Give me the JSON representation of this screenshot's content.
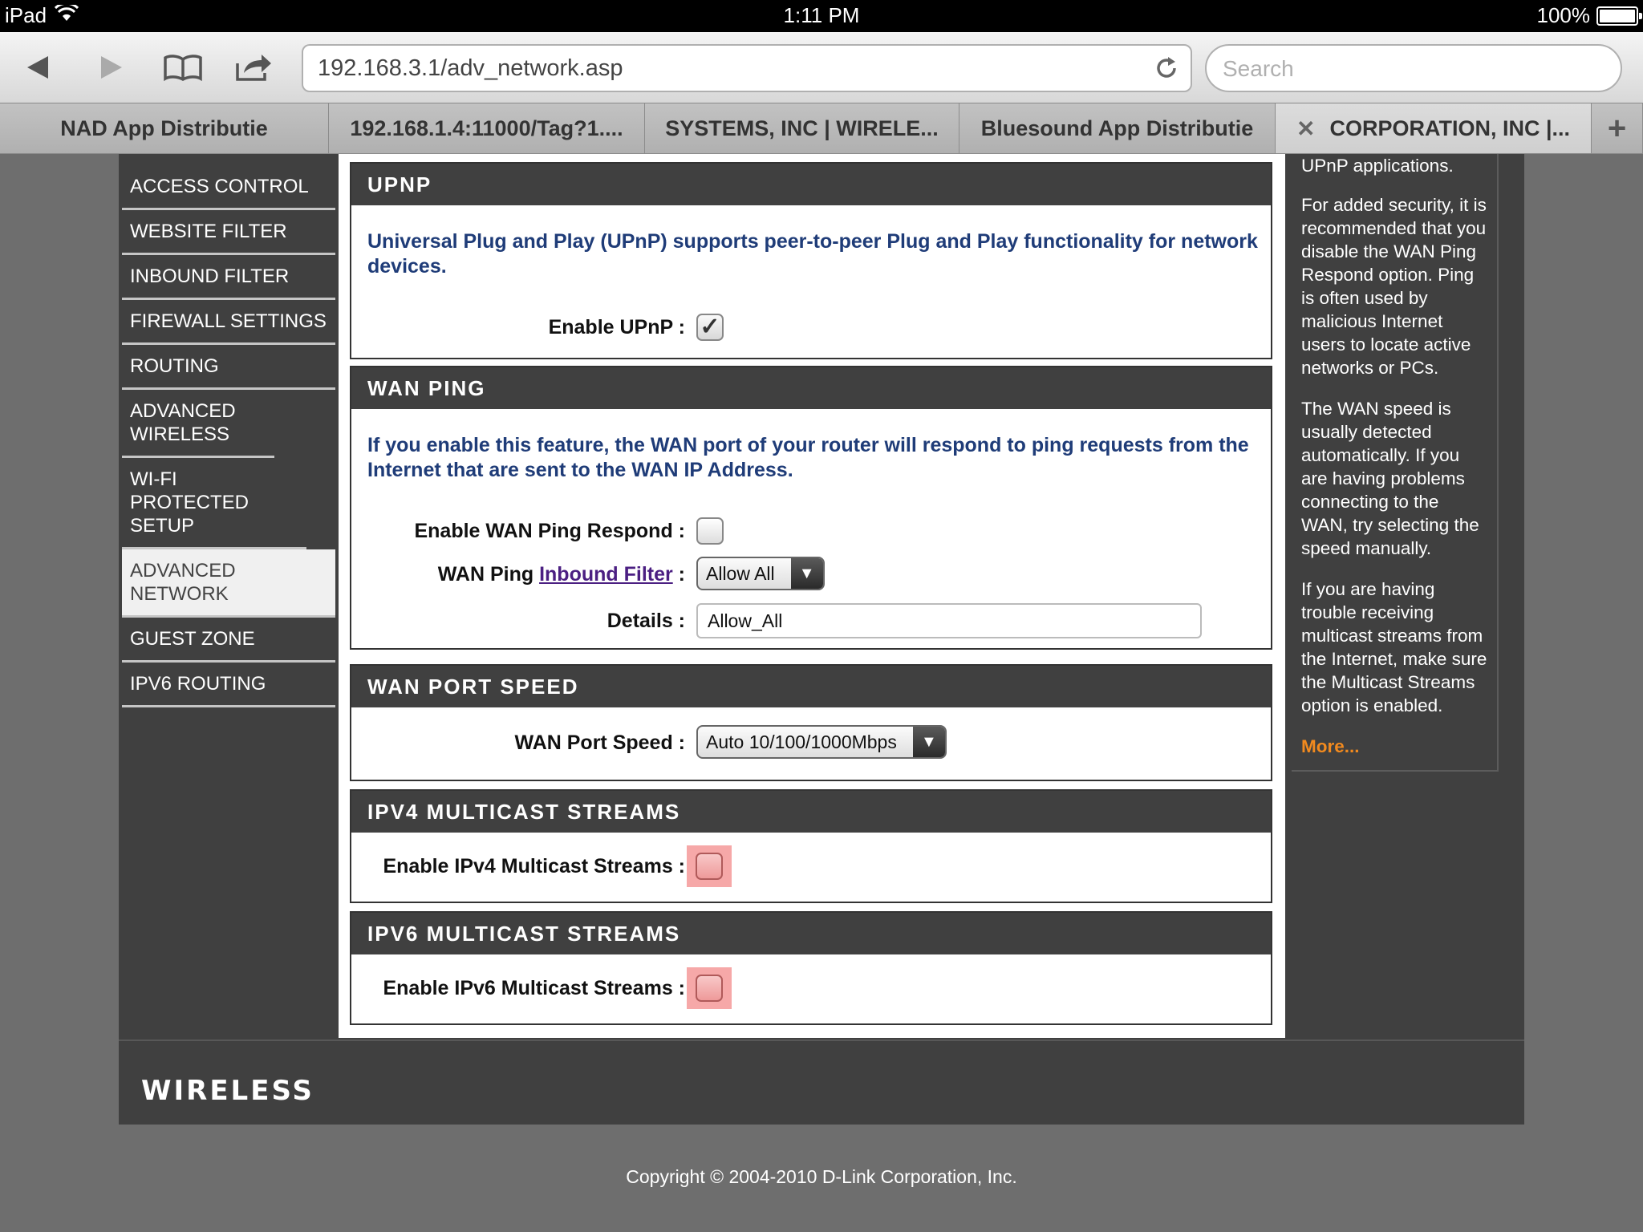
{
  "status_bar": {
    "device": "iPad",
    "time": "1:11 PM",
    "battery": "100%"
  },
  "browser": {
    "url": "192.168.3.1/adv_network.asp",
    "search_placeholder": "Search",
    "tabs": [
      {
        "label": "NAD App Distributie"
      },
      {
        "label": "192.168.1.4:11000/Tag?1...."
      },
      {
        "label": "SYSTEMS, INC | WIRELE..."
      },
      {
        "label": "Bluesound App Distributie"
      },
      {
        "label": "CORPORATION, INC |..."
      }
    ]
  },
  "sidebar": {
    "items": [
      {
        "label": "ACCESS CONTROL"
      },
      {
        "label": "WEBSITE FILTER"
      },
      {
        "label": "INBOUND FILTER"
      },
      {
        "label": "FIREWALL SETTINGS"
      },
      {
        "label": "ROUTING"
      },
      {
        "label": "ADVANCED WIRELESS"
      },
      {
        "label": "WI-FI PROTECTED SETUP"
      },
      {
        "label": "ADVANCED NETWORK"
      },
      {
        "label": "GUEST ZONE"
      },
      {
        "label": "IPV6 ROUTING"
      }
    ]
  },
  "upnp": {
    "title": "UPNP",
    "description": "Universal Plug and Play (UPnP) supports peer-to-peer Plug and Play functionality for network devices.",
    "enable_label": "Enable UPnP :",
    "enabled": true
  },
  "wan_ping": {
    "title": "WAN PING",
    "description": "If you enable this feature, the WAN port of your router will respond to ping requests from the Internet that are sent to the WAN IP Address.",
    "respond_label": "Enable WAN Ping Respond :",
    "respond_enabled": false,
    "filter_label_prefix": "WAN Ping",
    "filter_link": "Inbound Filter",
    "filter_label_suffix": ":",
    "filter_value": "Allow All",
    "details_label": "Details :",
    "details_value": "Allow_All"
  },
  "wan_port_speed": {
    "title": "WAN PORT SPEED",
    "label": "WAN Port Speed :",
    "value": "Auto 10/100/1000Mbps"
  },
  "ipv4_multicast": {
    "title": "IPV4 MULTICAST STREAMS",
    "label": "Enable IPv4 Multicast Streams :",
    "enabled": false
  },
  "ipv6_multicast": {
    "title": "IPV6 MULTICAST STREAMS",
    "label": "Enable IPv6 Multicast Streams :",
    "enabled": false
  },
  "help": {
    "p0": "UPnP applications.",
    "p1": "For added security, it is recommended that you disable the WAN Ping Respond option. Ping is often used by malicious Internet users to locate active networks or PCs.",
    "p2": "The WAN speed is usually detected automatically. If you are having problems connecting to the WAN, try selecting the speed manually.",
    "p3": "If you are having trouble receiving multicast streams from the Internet, make sure the Multicast Streams option is enabled.",
    "more": "More..."
  },
  "footer": {
    "logo": "WIRELESS",
    "copyright": "Copyright © 2004-2010 D-Link Corporation, Inc."
  }
}
